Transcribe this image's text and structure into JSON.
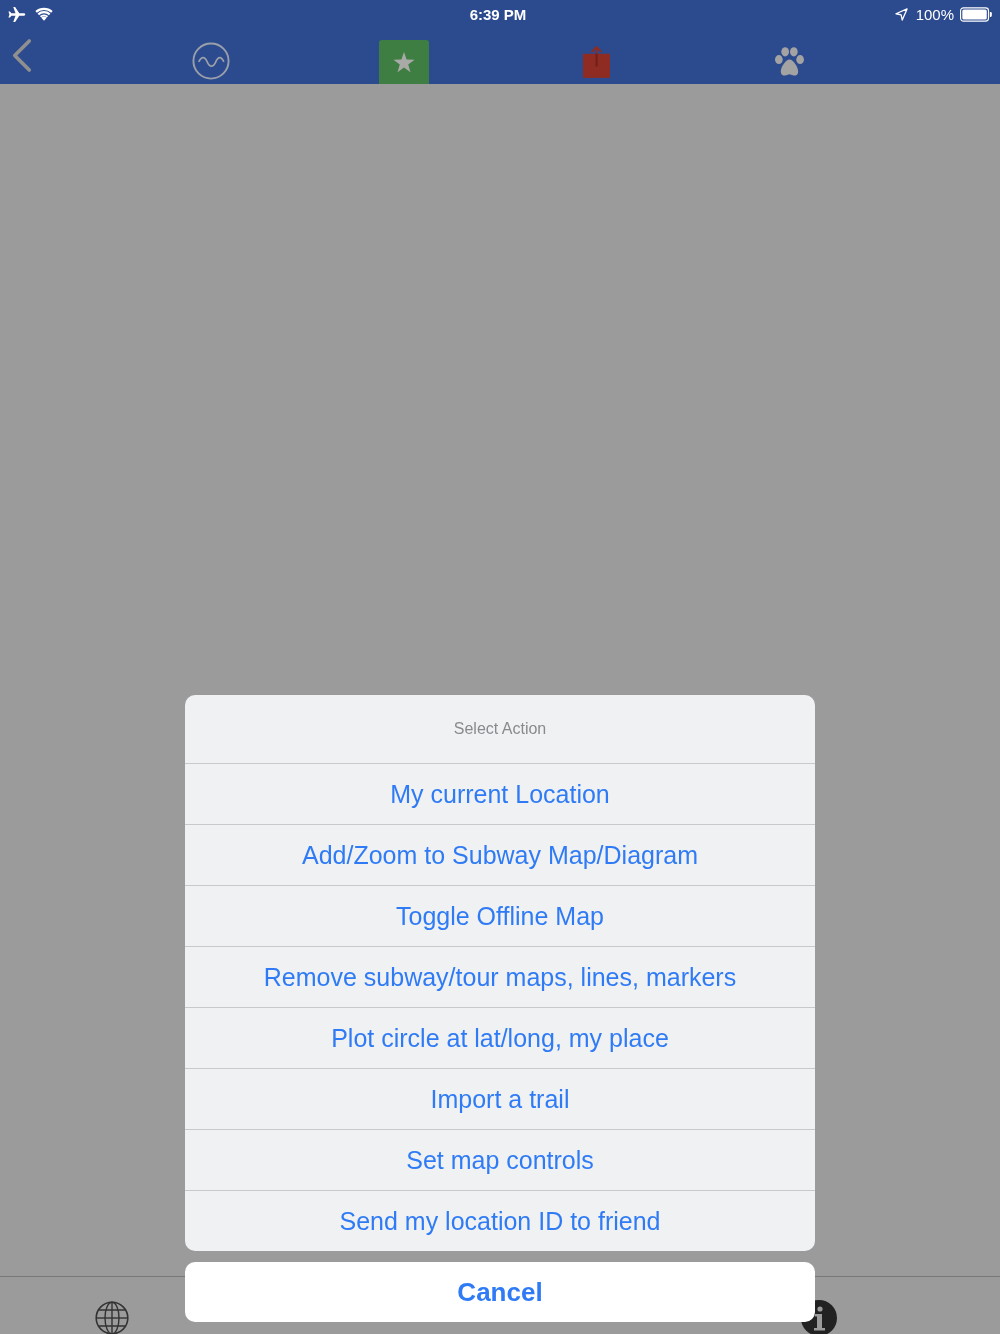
{
  "status_bar": {
    "time": "6:39 PM",
    "battery": "100%"
  },
  "toolbar": {
    "tabs": [
      {
        "kind": "wave",
        "selected": false
      },
      {
        "kind": "star",
        "selected": true
      },
      {
        "kind": "share",
        "selected": false
      },
      {
        "kind": "paw",
        "selected": false
      }
    ]
  },
  "action_sheet": {
    "title": "Select Action",
    "actions": [
      "My current Location",
      "Add/Zoom to Subway Map/Diagram",
      "Toggle Offline Map",
      "Remove subway/tour maps, lines, markers",
      "Plot circle at lat/long, my place",
      "Import a trail",
      "Set map controls",
      "Send my location ID to friend"
    ],
    "cancel": "Cancel"
  }
}
